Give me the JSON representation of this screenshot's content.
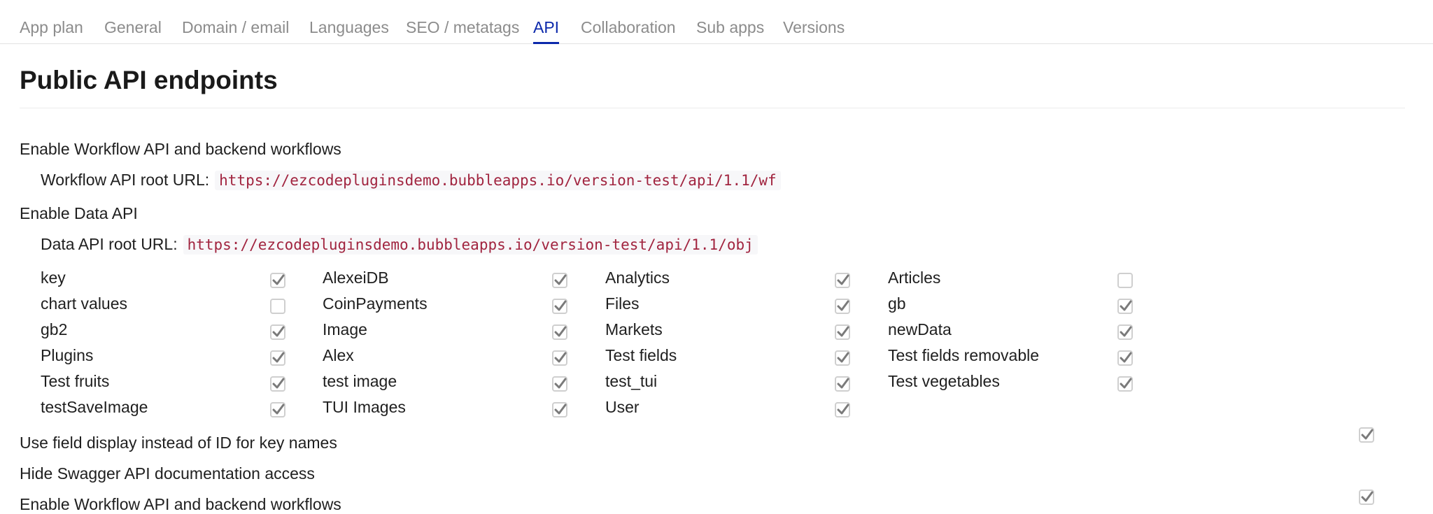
{
  "tabs": [
    {
      "label": "App plan",
      "active": false
    },
    {
      "label": "General",
      "active": false
    },
    {
      "label": "Domain / email",
      "active": false
    },
    {
      "label": "Languages",
      "active": false
    },
    {
      "label": "SEO / metatags",
      "active": false
    },
    {
      "label": "API",
      "active": true
    },
    {
      "label": "Collaboration",
      "active": false
    },
    {
      "label": "Sub apps",
      "active": false
    },
    {
      "label": "Versions",
      "active": false
    }
  ],
  "section": {
    "title": "Public API endpoints",
    "workflow_api_label": "Enable Workflow API and backend workflows",
    "workflow_root_label": "Workflow API root URL:",
    "workflow_root_url": "https://ezcodepluginsdemo.bubbleapps.io/version-test/api/1.1/wf",
    "data_api_label": "Enable Data API",
    "data_root_label": "Data API root URL:",
    "data_root_url": "https://ezcodepluginsdemo.bubbleapps.io/version-test/api/1.1/obj",
    "field_display_label": "Use field display instead of ID for key names",
    "hide_swagger_label": "Hide Swagger API documentation access",
    "workflow_api_label_2": "Enable Workflow API and backend workflows"
  },
  "data_types": [
    {
      "label": "key",
      "checked": true
    },
    {
      "label": "AlexeiDB",
      "checked": true
    },
    {
      "label": "Analytics",
      "checked": true
    },
    {
      "label": "Articles",
      "checked": false
    },
    {
      "label": "chart values",
      "checked": false
    },
    {
      "label": "CoinPayments",
      "checked": true
    },
    {
      "label": "Files",
      "checked": true
    },
    {
      "label": "gb",
      "checked": true
    },
    {
      "label": "gb2",
      "checked": true
    },
    {
      "label": "Image",
      "checked": true
    },
    {
      "label": "Markets",
      "checked": true
    },
    {
      "label": "newData",
      "checked": true
    },
    {
      "label": "Plugins",
      "checked": true
    },
    {
      "label": "Alex",
      "checked": true
    },
    {
      "label": "Test fields",
      "checked": true
    },
    {
      "label": "Test fields removable",
      "checked": true
    },
    {
      "label": "Test fruits",
      "checked": true
    },
    {
      "label": "test image",
      "checked": true
    },
    {
      "label": "test_tui",
      "checked": true
    },
    {
      "label": "Test vegetables",
      "checked": true
    },
    {
      "label": "testSaveImage",
      "checked": true
    },
    {
      "label": "TUI Images",
      "checked": true
    },
    {
      "label": "User",
      "checked": true
    }
  ],
  "settings": {
    "field_display_checked": true,
    "hide_swagger_checked": true
  },
  "colors": {
    "accent": "#0c29ab",
    "code_text": "#a1243f",
    "tab_inactive": "#8c8c8c",
    "checkbox_border": "#cfcfcf",
    "check_mark": "#7a7a7a"
  },
  "icons": {
    "check": "check-icon"
  }
}
